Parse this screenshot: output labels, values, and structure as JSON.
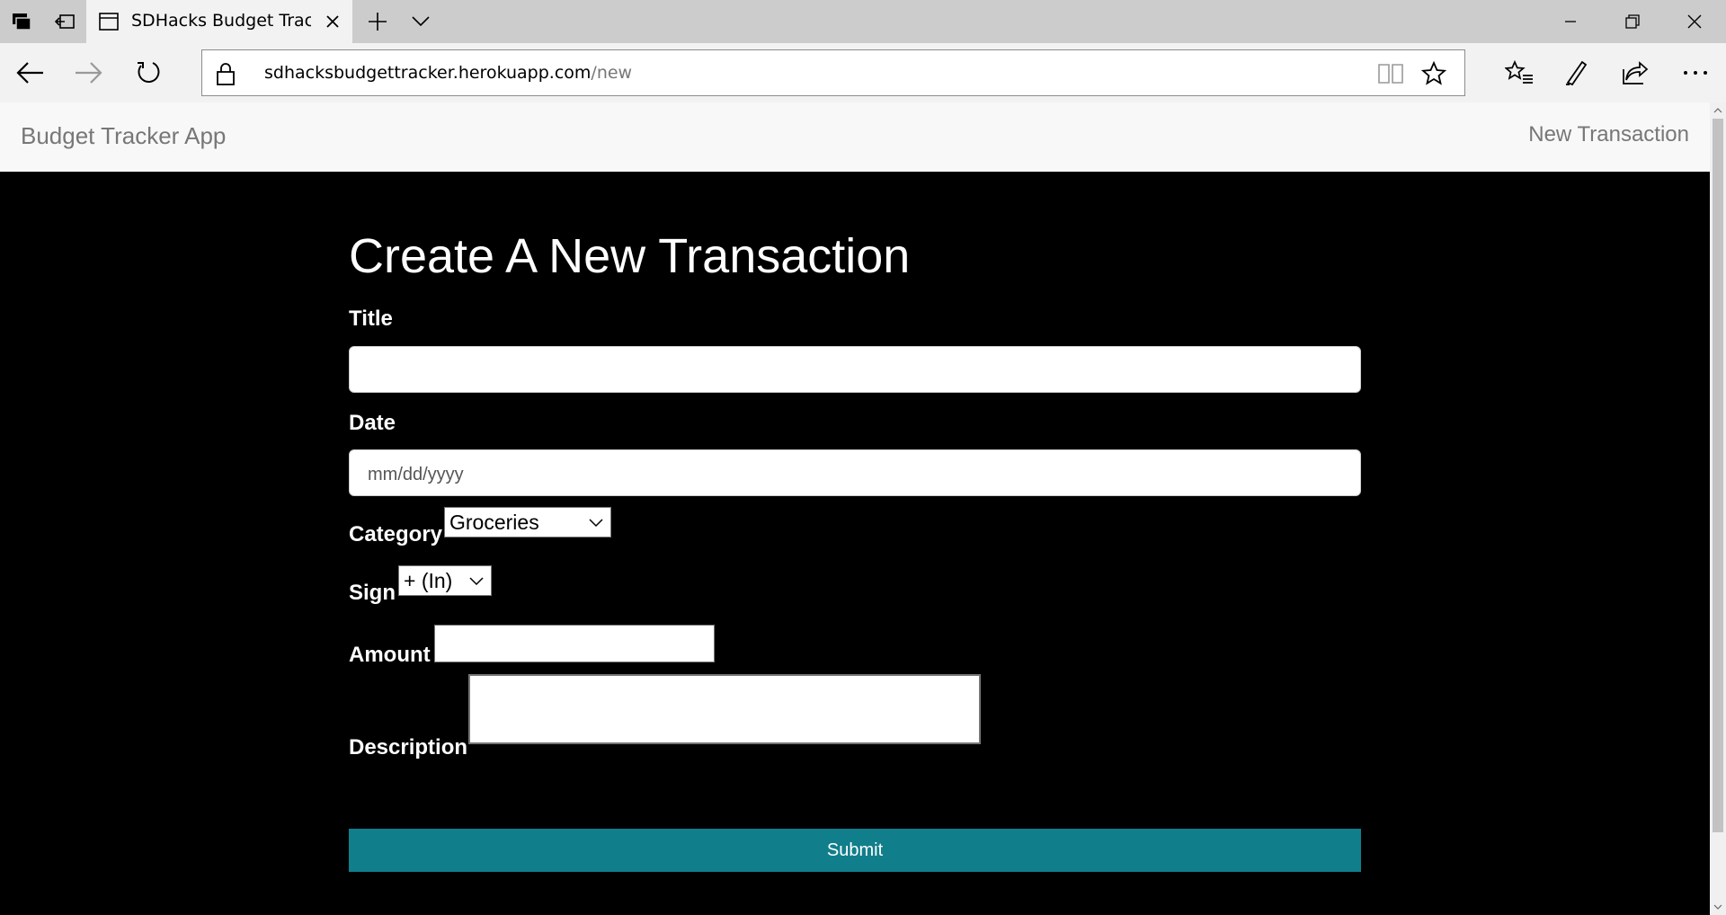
{
  "browser": {
    "tab_title": "SDHacks Budget Tracke",
    "url_host": "sdhacksbudgettracker.herokuapp.com",
    "url_path": "/new"
  },
  "site": {
    "brand": "Budget Tracker App",
    "nav_link": "New Transaction"
  },
  "form": {
    "heading": "Create A New Transaction",
    "title_label": "Title",
    "title_value": "",
    "date_label": "Date",
    "date_placeholder": "mm/dd/yyyy",
    "category_label": "Category",
    "category_selected": "Groceries",
    "sign_label": "Sign",
    "sign_selected": "+ (In)",
    "amount_label": "Amount",
    "amount_value": "",
    "description_label": "Description",
    "description_value": "",
    "submit_label": "Submit"
  },
  "colors": {
    "submit_bg": "#117e8b",
    "page_bg": "#000000",
    "nav_bg": "#f8f8f8"
  }
}
